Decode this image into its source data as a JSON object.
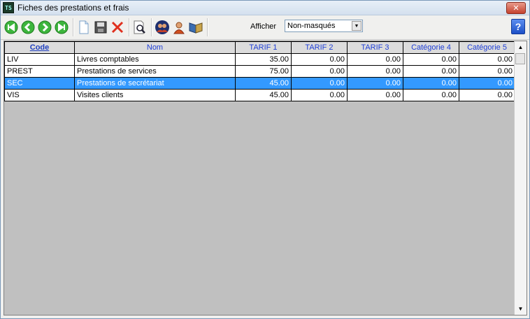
{
  "window": {
    "title": "Fiches des prestations et frais",
    "app_icon_text": "TS",
    "close_label": "✕"
  },
  "toolbar": {
    "buttons": [
      {
        "name": "first-record-icon"
      },
      {
        "name": "previous-record-icon"
      },
      {
        "name": "next-record-icon"
      },
      {
        "name": "last-record-icon"
      },
      {
        "name": "new-document-icon"
      },
      {
        "name": "save-icon"
      },
      {
        "name": "delete-icon"
      },
      {
        "name": "preview-search-icon"
      },
      {
        "name": "contacts-icon"
      },
      {
        "name": "user-icon"
      },
      {
        "name": "book-icon"
      }
    ],
    "afficher_label": "Afficher",
    "afficher_value": "Non-masqués",
    "help_label": "?"
  },
  "table": {
    "columns": [
      "Code",
      "Nom",
      "TARIF 1",
      "TARIF 2",
      "TARIF 3",
      "Catégorie 4",
      "Catégorie 5"
    ],
    "rows": [
      [
        "LIV",
        "Livres comptables",
        "35.00",
        "0.00",
        "0.00",
        "0.00",
        "0.00"
      ],
      [
        "PREST",
        "Prestations de services",
        "75.00",
        "0.00",
        "0.00",
        "0.00",
        "0.00"
      ],
      [
        "SEC",
        "Prestations de secrétariat",
        "45.00",
        "0.00",
        "0.00",
        "0.00",
        "0.00"
      ],
      [
        "VIS",
        "Visites clients",
        "45.00",
        "0.00",
        "0.00",
        "0.00",
        "0.00"
      ]
    ],
    "selected_row": 2
  },
  "colors": {
    "selection": "#3399ff",
    "header_text": "#1f3fd6",
    "empty_area": "#c0c0c0"
  }
}
